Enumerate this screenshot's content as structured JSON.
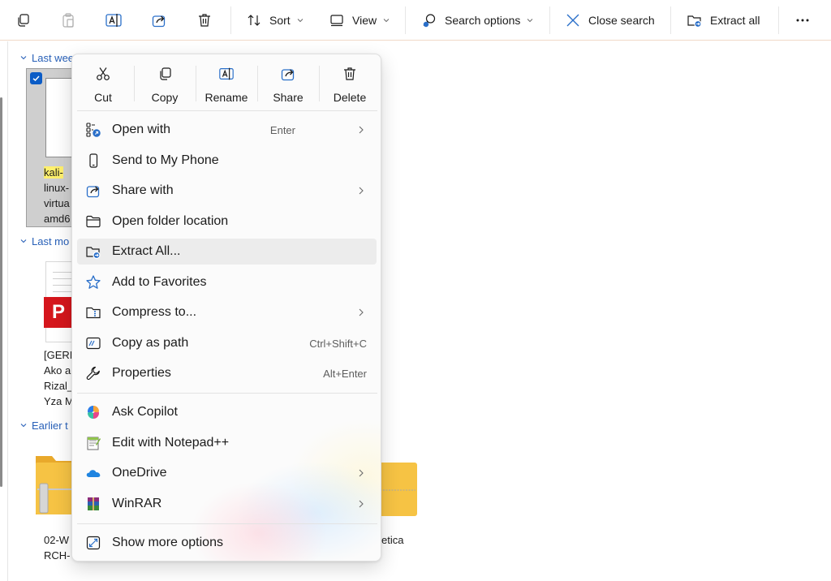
{
  "toolbar": {
    "sort_label": "Sort",
    "view_label": "View",
    "search_options_label": "Search options",
    "close_search_label": "Close search",
    "extract_all_label": "Extract all"
  },
  "groups": [
    {
      "label": "Last wee"
    },
    {
      "label": "Last mo"
    },
    {
      "label": "Earlier t"
    }
  ],
  "files": {
    "kali": {
      "highlight": "kali-",
      "lines": [
        "linux-",
        "virtua",
        "amd6"
      ]
    },
    "pdf": {
      "badge": "P",
      "lines": [
        "[GERI",
        "Ako a",
        "Rizal_",
        "Yza M"
      ]
    },
    "zip1": {
      "lines": [
        "02-W",
        "RCH-"
      ]
    },
    "zip2": {
      "lines": [
        "etica"
      ]
    }
  },
  "context_menu": {
    "quick_actions": [
      {
        "label": "Cut"
      },
      {
        "label": "Copy"
      },
      {
        "label": "Rename"
      },
      {
        "label": "Share"
      },
      {
        "label": "Delete"
      }
    ],
    "items": [
      {
        "label": "Open with",
        "shortcut": "Enter"
      },
      {
        "label": "Send to My Phone"
      },
      {
        "label": "Share with"
      },
      {
        "label": "Open folder location"
      },
      {
        "label": "Extract All..."
      },
      {
        "label": "Add to Favorites"
      },
      {
        "label": "Compress to..."
      },
      {
        "label": "Copy as path",
        "shortcut": "Ctrl+Shift+C"
      },
      {
        "label": "Properties",
        "shortcut": "Alt+Enter"
      },
      {
        "label": "Ask Copilot"
      },
      {
        "label": "Edit with Notepad++"
      },
      {
        "label": "OneDrive"
      },
      {
        "label": "WinRAR"
      },
      {
        "label": "Show more options"
      }
    ]
  },
  "colors": {
    "accent": "#0b5cc6",
    "group_header": "#2860b8",
    "pdf_red": "#d5161c",
    "zip_yellow": "#f2c13b"
  }
}
